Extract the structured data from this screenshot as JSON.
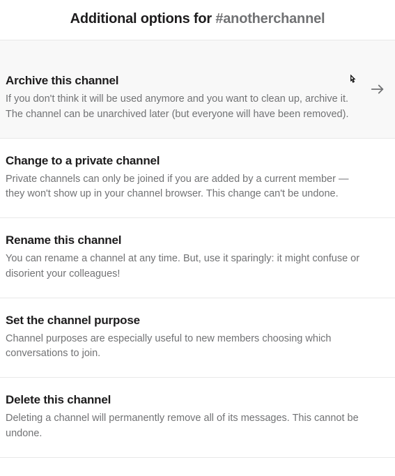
{
  "header": {
    "title_prefix": "Additional options for ",
    "channel_name": "#anotherchannel"
  },
  "options": [
    {
      "title": "Archive this channel",
      "description": "If you don't think it will be used anymore and you want to clean up, archive it. The channel can be unarchived later (but everyone will have been removed).",
      "hovered": true
    },
    {
      "title": "Change to a private channel",
      "description": "Private channels can only be joined if you are added by a current member — they won't show up in your channel browser. This change can't be undone."
    },
    {
      "title": "Rename this channel",
      "description": "You can rename a channel at any time. But, use it sparingly: it might confuse or disorient your colleagues!"
    },
    {
      "title": "Set the channel purpose",
      "description": "Channel purposes are especially useful to new members choosing which conversations to join."
    },
    {
      "title": "Delete this channel",
      "description": "Deleting a channel will permanently remove all of its messages. This cannot be undone."
    }
  ]
}
